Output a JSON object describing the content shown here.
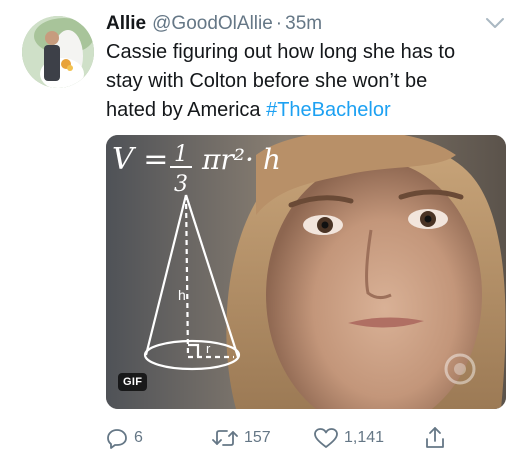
{
  "tweet": {
    "display_name": "Allie",
    "handle": "@GoodOlAllie",
    "separator": "·",
    "timestamp": "35m",
    "text_lines": [
      "Cassie figuring out how long she has to",
      "stay with Colton before she won’t be",
      "hated by America "
    ],
    "hashtag": "#TheBachelor"
  },
  "media": {
    "type_badge": "GIF",
    "formula_prefix": "V = ",
    "formula_fraction_num": "1",
    "formula_fraction_den": "3",
    "formula_suffix": "πr²· h",
    "cone_height_label": "h",
    "cone_radius_label": "r"
  },
  "actions": {
    "replies": "6",
    "retweets": "157",
    "likes": "1,141"
  },
  "colors": {
    "text": "#14171a",
    "secondary": "#657786",
    "link": "#1da1f2"
  },
  "icons": [
    "avatar",
    "chevron-down-icon",
    "reply-icon",
    "retweet-icon",
    "like-icon",
    "share-icon"
  ]
}
